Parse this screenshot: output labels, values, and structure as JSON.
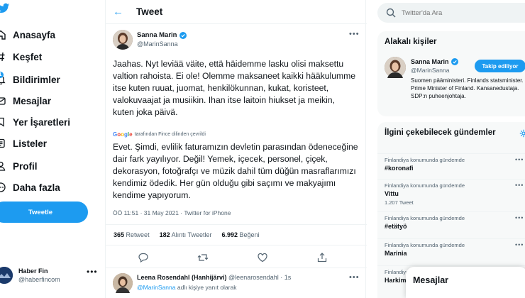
{
  "nav": {
    "items": [
      {
        "label": "Anasayfa",
        "icon": "home-icon"
      },
      {
        "label": "Keşfet",
        "icon": "hashtag-icon"
      },
      {
        "label": "Bildirimler",
        "icon": "bell-icon",
        "badge": "11"
      },
      {
        "label": "Mesajlar",
        "icon": "mail-icon"
      },
      {
        "label": "Yer İşaretleri",
        "icon": "bookmark-icon"
      },
      {
        "label": "Listeler",
        "icon": "list-icon"
      },
      {
        "label": "Profil",
        "icon": "profile-icon"
      },
      {
        "label": "Daha fazla",
        "icon": "more-circle-icon"
      }
    ],
    "tweet_button": "Tweetle"
  },
  "account": {
    "name": "Haber Fin",
    "handle": "@haberfincom"
  },
  "header": {
    "title": "Tweet"
  },
  "tweet": {
    "author_name": "Sanna Marin",
    "author_handle": "@MarinSanna",
    "text": "Jaahas. Nyt leviää väite, että häidemme lasku olisi maksettu valtion rahoista. Ei ole! Olemme maksaneet kaikki hääkulumme itse kuten ruuat, juomat, henkilökunnan, kukat, koristeet, valokuvaajat ja musiikin. Ihan itse laitoin hiukset ja meikin, kuten joka päivä.",
    "translated_by": "tarafından Fince dilinden çevrildi",
    "translated_brand": "Google",
    "translation": "Evet. Şimdi, evlilik faturamızın devletin parasından ödeneceğine dair fark yayılıyor. Değil! Yemek, içecek, personel, çiçek, dekorasyon, fotoğrafçı ve müzik dahil tüm düğün masraflarımızı kendimiz ödedik. Her gün olduğu gibi saçımı ve makyajımı kendime yapıyorum.",
    "meta": "ÖÖ 11:51 · 31 May 2021 · Twitter for iPhone",
    "retweets": "365",
    "retweets_label": "Retweet",
    "quotes": "182",
    "quotes_label": "Alıntı Tweetler",
    "likes": "6.992",
    "likes_label": "Beğeni"
  },
  "reply": {
    "name": "Leena Rosendahl (Hanhijärvi)",
    "handle": "@leenarosendahl · 1s",
    "reply_to_handle": "@MarinSanna",
    "reply_to_suffix": "adlı kişiye yanıt olarak"
  },
  "search": {
    "placeholder": "Twitter'da Ara"
  },
  "related": {
    "title": "Alakalı kişiler",
    "name": "Sanna Marin",
    "handle": "@MarinSanna",
    "follow_label": "Takip ediliyor",
    "bio": "Suomen pääministeri. Finlands statsminister. Prime Minister of Finland. Kansanedustaja. SDP:n puheenjohtaja."
  },
  "trends": {
    "title": "İlgini çekebilecek gündemler",
    "items": [
      {
        "context": "Finlandiya konumunda gündemde",
        "topic": "#koronafi",
        "count": ""
      },
      {
        "context": "Finlandiya konumunda gündemde",
        "topic": "Vittu",
        "count": "1.207 Tweet"
      },
      {
        "context": "Finlandiya konumunda gündemde",
        "topic": "#etätyö",
        "count": ""
      },
      {
        "context": "Finlandiya konumunda gündemde",
        "topic": "Marinia",
        "count": ""
      },
      {
        "context": "Finlandiya konumunda gündemde",
        "topic": "Harkim",
        "count": ""
      }
    ]
  },
  "messages_bar": {
    "label": "Mesajlar"
  },
  "colors": {
    "accent": "#1d9bf0",
    "text": "#0f1419",
    "muted": "#536471"
  }
}
